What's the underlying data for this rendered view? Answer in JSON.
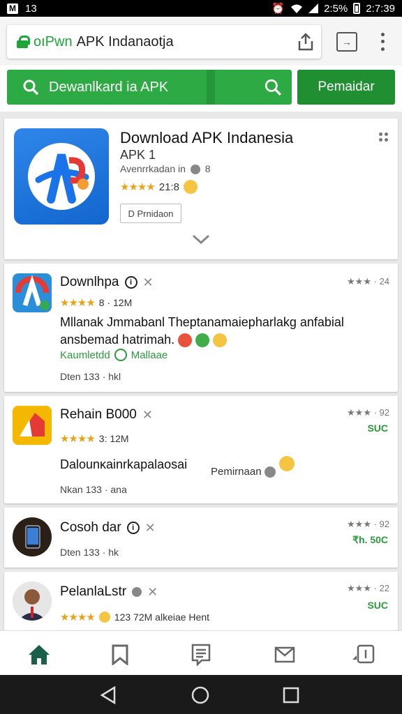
{
  "status_bar": {
    "left_badge": "M",
    "left_text": "13",
    "battery_text": "2:5%",
    "time": "2:7:39"
  },
  "browser": {
    "url_prefix": "oıPwn",
    "url_text": "APK Indanaotja",
    "tabs_count": "→"
  },
  "search": {
    "query": "Dewanlkard ia APK",
    "primary_button": "Pemaidar"
  },
  "hero": {
    "title": "Download APK Indanesia",
    "subtitle": "APK 1",
    "developer": "Avenrrkadan in",
    "developer_badge": "8",
    "rating_text": "21:8",
    "button_label": "D Prnidaon"
  },
  "apps": [
    {
      "title": "Downlhpa",
      "meta_stars_text": "8 · 12M",
      "rating_right": "★★★ · 24",
      "desc": "Mllanak Jmmabanl Theptanamaiepharlakg anfabial ansbemad hatrimah.",
      "tag_left": "Kaumletdd",
      "tag_right": "Mallaae",
      "footer": "Dten 133 · hkl"
    },
    {
      "title": "Rehain B000",
      "meta_stars_text": "3: 12M",
      "rating_right": "★★★ · 92",
      "price": "SUC",
      "desc": "Dalounĸainrkapalaosai",
      "desc_side": "Pemirnaan",
      "footer": "Nkan 133 · ana"
    },
    {
      "title": "Cosoh dar",
      "rating_right": "★★★ · 92",
      "price": "₹h. 50C",
      "footer": "Dten 133 · hk"
    },
    {
      "title": "PelanlaLstr",
      "rating_right": "★★★ · 22",
      "price": "SUC",
      "meta_stars_text": "123 72M alkeiae Hent"
    }
  ],
  "colors": {
    "accent_green": "#2eaa44",
    "dark_green": "#1f8f32",
    "star": "#e8a317",
    "blue_icon": "#1a73e8"
  }
}
